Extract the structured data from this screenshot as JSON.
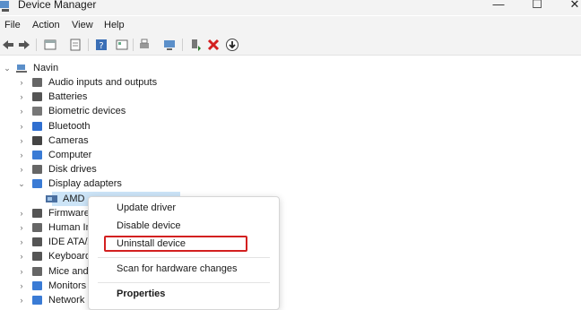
{
  "window": {
    "title": "Device Manager",
    "minimize": "—",
    "maximize": "☐",
    "close": "✕"
  },
  "menu": [
    "File",
    "Action",
    "View",
    "Help"
  ],
  "tree": {
    "root": "Navin",
    "categories": [
      {
        "label": "Audio inputs and outputs",
        "icon": "speaker-icon"
      },
      {
        "label": "Batteries",
        "icon": "battery-icon"
      },
      {
        "label": "Biometric devices",
        "icon": "fingerprint-icon"
      },
      {
        "label": "Bluetooth",
        "icon": "bluetooth-icon"
      },
      {
        "label": "Cameras",
        "icon": "camera-icon"
      },
      {
        "label": "Computer",
        "icon": "monitor-icon"
      },
      {
        "label": "Disk drives",
        "icon": "disk-drive-icon"
      },
      {
        "label": "Display adapters",
        "icon": "display-adapter-icon"
      },
      {
        "label": "Firmware",
        "icon": "firmware-icon"
      },
      {
        "label": "Human In",
        "icon": "hid-icon"
      },
      {
        "label": "IDE ATA/A",
        "icon": "ide-controller-icon"
      },
      {
        "label": "Keyboards",
        "icon": "keyboard-icon"
      },
      {
        "label": "Mice and",
        "icon": "mouse-icon"
      },
      {
        "label": "Monitors",
        "icon": "monitor-icon"
      },
      {
        "label": "Network",
        "icon": "network-icon"
      }
    ],
    "selected_device": "AMD"
  },
  "context_menu": {
    "update_driver": "Update driver",
    "disable_device": "Disable device",
    "uninstall_device": "Uninstall device",
    "scan": "Scan for hardware changes",
    "properties": "Properties"
  },
  "colors": {
    "accent_highlight": "#d32020",
    "selection": "#cce4f7"
  }
}
